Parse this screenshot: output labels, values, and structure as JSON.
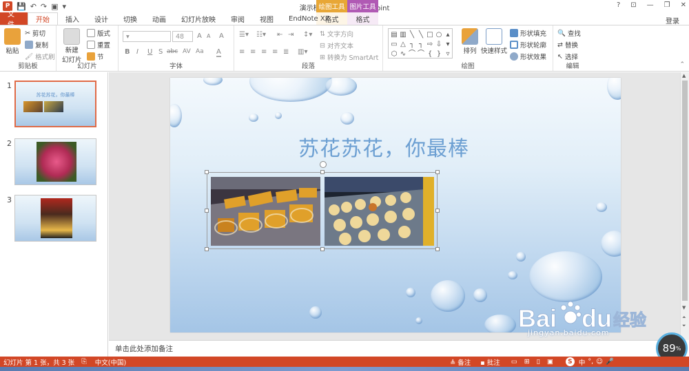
{
  "titlebar": {
    "app_logo": "P",
    "document_title": "演示模板.pptx - PowerPoint",
    "context_drawing_header": "绘图工具",
    "context_picture_header": "图片工具",
    "context_drawing_tab": "格式",
    "context_picture_tab": "格式",
    "help": "?",
    "ribbon_display": "⊡",
    "minimize": "—",
    "restore": "❐",
    "close": "✕",
    "login": "登录"
  },
  "tabs": [
    {
      "label": "文件"
    },
    {
      "label": "开始"
    },
    {
      "label": "插入"
    },
    {
      "label": "设计"
    },
    {
      "label": "切换"
    },
    {
      "label": "动画"
    },
    {
      "label": "幻灯片放映"
    },
    {
      "label": "审阅"
    },
    {
      "label": "视图"
    },
    {
      "label": "EndNote X7"
    }
  ],
  "ribbon": {
    "clipboard": {
      "paste": "粘贴",
      "cut": "剪切",
      "copy": "复制",
      "format_painter": "格式刷",
      "label": "剪贴板"
    },
    "slides": {
      "new_slide": "新建",
      "new_slide_2": "幻灯片",
      "layout": "版式",
      "reset": "重置",
      "section": "节",
      "label": "幻灯片"
    },
    "font": {
      "size": "48",
      "label": "字体",
      "bold": "B",
      "italic": "I",
      "underline": "U",
      "shadow": "S",
      "strike": "abc",
      "spacing": "AV",
      "case": "Aa",
      "color": "A",
      "grow": "A",
      "shrink": "A",
      "clear": "A"
    },
    "paragraph": {
      "text_direction": "文字方向",
      "align_text": "对齐文本",
      "smartart": "转换为 SmartArt",
      "label": "段落"
    },
    "drawing": {
      "arrange": "排列",
      "quick_styles": "快速样式",
      "shape_fill": "形状填充",
      "shape_outline": "形状轮廓",
      "shape_effects": "形状效果",
      "label": "绘图"
    },
    "editing": {
      "find": "查找",
      "replace": "替换",
      "select": "选择",
      "label": "编辑"
    }
  },
  "thumbnails": [
    {
      "number": "1",
      "title": "苏花苏花，你最棒"
    },
    {
      "number": "2"
    },
    {
      "number": "3"
    }
  ],
  "slide": {
    "title": "苏花苏花，你最棒"
  },
  "notes": {
    "placeholder": "单击此处添加备注"
  },
  "statusbar": {
    "slide_info": "幻灯片 第 1 张，共 3 张",
    "language": "中文(中国)",
    "notes": "备注",
    "comments": "批注"
  },
  "watermark": {
    "brand": "Bai",
    "brand2": "du",
    "cn": "经验",
    "url": "jingyan.baidu.com"
  },
  "gauge": {
    "value": "89",
    "unit": "%"
  },
  "colors": {
    "accent": "#d24726",
    "drawing_tools": "#e8a736",
    "picture_tools": "#b05ab4",
    "title_text": "#6c9fd2"
  }
}
